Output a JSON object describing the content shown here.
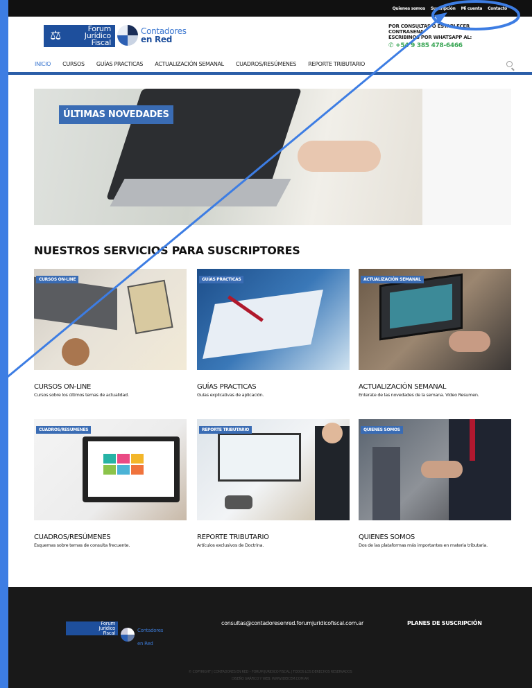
{
  "topbar": {
    "links": [
      "Quienes somos",
      "Suscripción",
      "Mi cuenta",
      "Contacto"
    ]
  },
  "header": {
    "logo_forum": [
      "Forum",
      "Jurídico",
      "Fiscal"
    ],
    "logo_cr": [
      "Contadores",
      "en Red"
    ],
    "contact_line1": "POR CONSULTAS O ESTABLECER CONTRASEÑA",
    "contact_line2": "ESCRIBINOS POR WHATSAPP AL:",
    "whatsapp": "+54 9 385 478-6466"
  },
  "nav": {
    "items": [
      "INICIO",
      "CURSOS",
      "GUÍAS PRACTICAS",
      "ACTUALIZACIÓN SEMANAL",
      "CUADROS/RESÚMENES",
      "REPORTE TRIBUTARIO"
    ],
    "active": 0
  },
  "hero": {
    "badge": "ÚLTIMAS NOVEDADES"
  },
  "services": {
    "title": "NUESTROS SERVICIOS PARA SUSCRIPTORES",
    "cards": [
      {
        "tag": "CURSOS ON-LINE",
        "title": "CURSOS ON-LINE",
        "desc": "Cursos sobre los últimos temas de actualidad."
      },
      {
        "tag": "GUÍAS PRACTICAS",
        "title": "GUÍAS PRACTICAS",
        "desc": "Guías explicativas de aplicación."
      },
      {
        "tag": "ACTUALIZACIÓN SEMANAL",
        "title": "ACTUALIZACIÓN SEMANAL",
        "desc": "Enterate de las novedades de la semana. Video Resumen."
      },
      {
        "tag": "CUADROS/RESUMENES",
        "title": "CUADROS/RESÚMENES",
        "desc": "Esquemas sobre temas de consulta frecuente."
      },
      {
        "tag": "REPORTE TRIBUTARIO",
        "title": "REPORTE TRIBUTARIO",
        "desc": "Artículos exclusivos de Doctrina."
      },
      {
        "tag": "QUIENES SOMOS",
        "title": "QUIENES SOMOS",
        "desc": "Dos de las plataformas más importantes en materia tributaria."
      }
    ]
  },
  "footer": {
    "logo_forum": [
      "Forum",
      "Jurídico",
      "Fiscal"
    ],
    "logo_cr": [
      "Contadores",
      "en Red"
    ],
    "email": "consultas@contadoresenred.forumjuridicofiscal.com.ar",
    "plans": "PLANES DE SUSCRIPCIÓN",
    "copyright": "© COPYRIGHT | CONTADORES EN RED – FORUM JURIDICO FISCAL | TODOS LOS DERECHOS RESERVADOS",
    "design": "DISEÑO GRÁFICO Y WEB: WWW.IDEICEM.COM.AR"
  },
  "colors": {
    "accent": "#3d7de3",
    "brand": "#1e4f9c",
    "whatsapp": "#3aa655"
  }
}
